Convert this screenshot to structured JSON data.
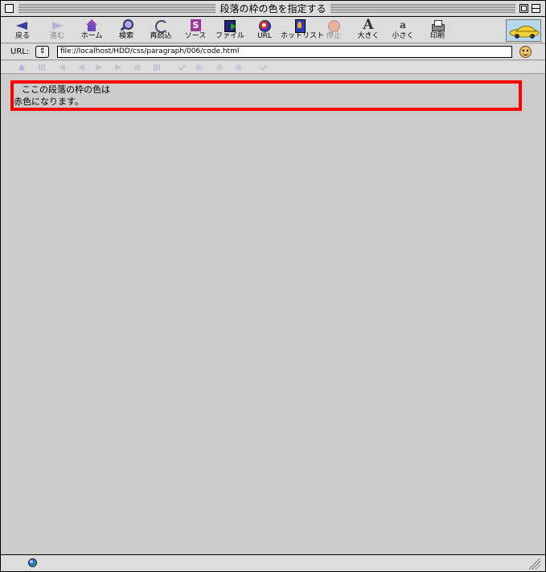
{
  "window": {
    "title": "段落の枠の色を指定する"
  },
  "toolbar": {
    "buttons": [
      {
        "label": "戻る",
        "icon": "back-arrow-icon",
        "enabled": true
      },
      {
        "label": "進む",
        "icon": "forward-arrow-icon",
        "enabled": false
      },
      {
        "label": "ホーム",
        "icon": "home-icon",
        "enabled": true
      },
      {
        "label": "検索",
        "icon": "search-icon",
        "enabled": true
      },
      {
        "label": "再読込",
        "icon": "reload-icon",
        "enabled": true
      },
      {
        "label": "ソース",
        "icon": "source-icon",
        "enabled": true
      },
      {
        "label": "ファイル",
        "icon": "file-icon",
        "enabled": true
      },
      {
        "label": "URL",
        "icon": "url-globe-icon",
        "enabled": true
      },
      {
        "label": "ホットリスト",
        "icon": "hotlist-icon",
        "enabled": true
      },
      {
        "label": "停止",
        "icon": "stop-icon",
        "enabled": false
      },
      {
        "label": "大きく",
        "icon": "font-larger-icon",
        "enabled": true
      },
      {
        "label": "小さく",
        "icon": "font-smaller-icon",
        "enabled": true
      },
      {
        "label": "印刷",
        "icon": "print-icon",
        "enabled": true
      }
    ],
    "logo": "car-logo"
  },
  "urlbar": {
    "label": "URL:",
    "stepper": "⇕",
    "value": "file://localhost/HDD/css/paragraph/006/code.html"
  },
  "content": {
    "paragraph_line1": "ここの段落の枠の色は",
    "paragraph_line2": "赤色になります。",
    "border_color": "#ff0000",
    "background_color": "#cccccc"
  },
  "statusbar": {
    "icon": "globe-icon"
  }
}
